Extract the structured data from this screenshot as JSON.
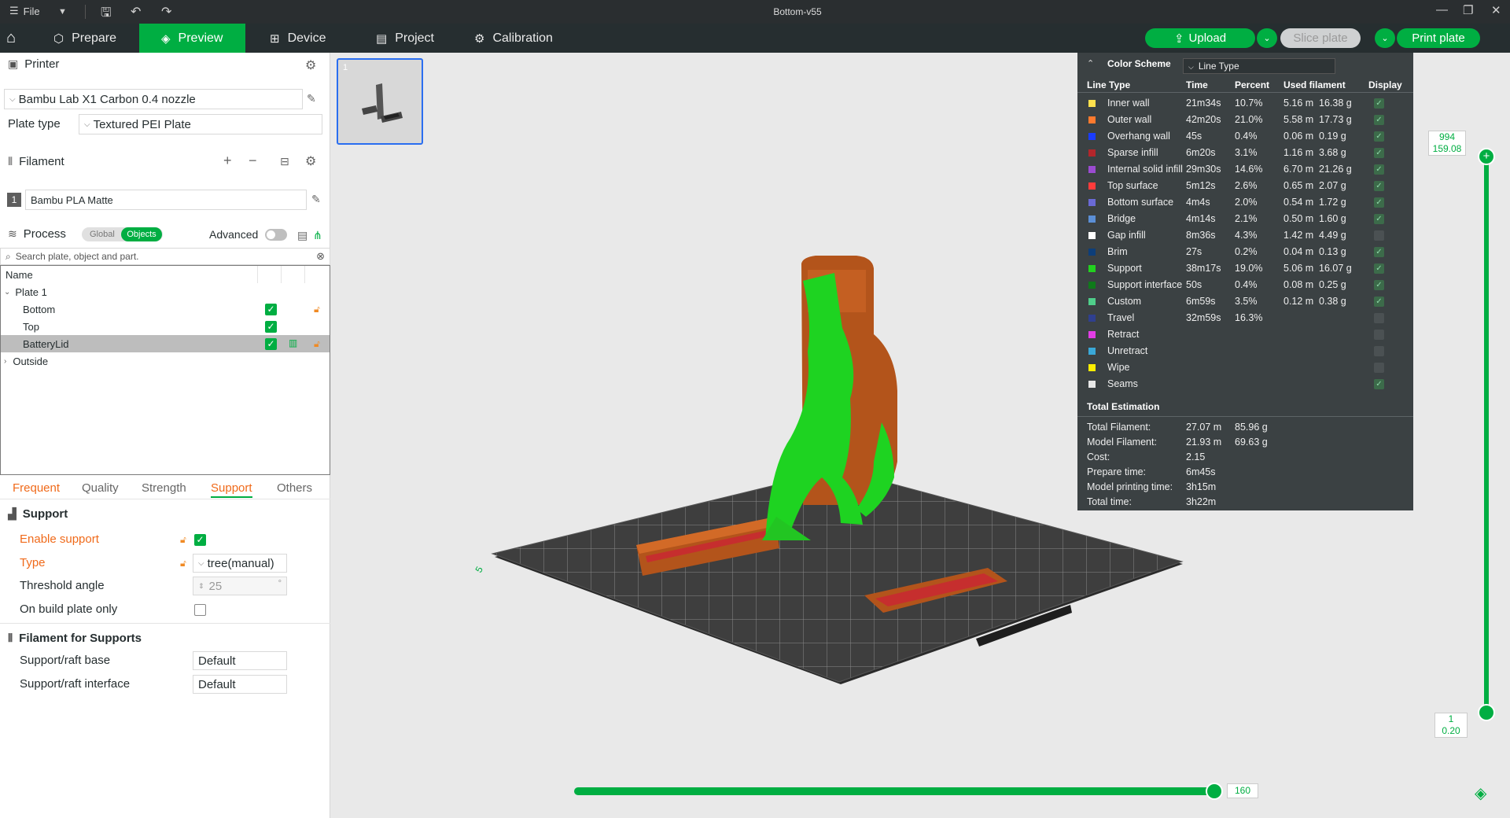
{
  "titlebar": {
    "file": "File",
    "title": "Bottom-v55"
  },
  "nav": {
    "tabs": [
      {
        "label": "Prepare"
      },
      {
        "label": "Preview"
      },
      {
        "label": "Device"
      },
      {
        "label": "Project"
      },
      {
        "label": "Calibration"
      }
    ],
    "upload": "Upload",
    "slice": "Slice plate",
    "print": "Print plate"
  },
  "printer": {
    "section": "Printer",
    "name": "Bambu Lab X1 Carbon 0.4 nozzle",
    "plate_type_label": "Plate type",
    "plate_type": "Textured PEI Plate"
  },
  "filament": {
    "section": "Filament",
    "index": "1",
    "name": "Bambu PLA Matte"
  },
  "process": {
    "section": "Process",
    "global": "Global",
    "objects": "Objects",
    "advanced": "Advanced",
    "search_placeholder": "Search plate, object and part."
  },
  "tree": {
    "header": "Name",
    "plate": "Plate 1",
    "items": [
      "Bottom",
      "Top",
      "BatteryLid"
    ],
    "outside": "Outside"
  },
  "subtabs": [
    "Frequent",
    "Quality",
    "Strength",
    "Support",
    "Others"
  ],
  "support": {
    "title": "Support",
    "enable": "Enable support",
    "type_label": "Type",
    "type_value": "tree(manual)",
    "threshold_label": "Threshold angle",
    "threshold_value": "25",
    "threshold_unit": "°",
    "buildplate": "On build plate only",
    "filament_title": "Filament for Supports",
    "base_label": "Support/raft base",
    "base_value": "Default",
    "iface_label": "Support/raft interface",
    "iface_value": "Default"
  },
  "plate_thumb": {
    "number": "1"
  },
  "legend": {
    "scheme_label": "Color Scheme",
    "scheme_value": "Line Type",
    "headers": {
      "type": "Line Type",
      "time": "Time",
      "percent": "Percent",
      "used": "Used filament",
      "display": "Display"
    },
    "rows": [
      {
        "name": "Inner wall",
        "color": "#ffe14d",
        "time": "21m34s",
        "pct": "10.7%",
        "len": "5.16 m",
        "wt": "16.38 g",
        "on": true
      },
      {
        "name": "Outer wall",
        "color": "#ff7a2e",
        "time": "42m20s",
        "pct": "21.0%",
        "len": "5.58 m",
        "wt": "17.73 g",
        "on": true
      },
      {
        "name": "Overhang wall",
        "color": "#1a3cff",
        "time": "45s",
        "pct": "0.4%",
        "len": "0.06 m",
        "wt": "0.19 g",
        "on": true
      },
      {
        "name": "Sparse infill",
        "color": "#b3262b",
        "time": "6m20s",
        "pct": "3.1%",
        "len": "1.16 m",
        "wt": "3.68 g",
        "on": true
      },
      {
        "name": "Internal solid infill",
        "color": "#9b4bd1",
        "time": "29m30s",
        "pct": "14.6%",
        "len": "6.70 m",
        "wt": "21.26 g",
        "on": true
      },
      {
        "name": "Top surface",
        "color": "#ff3b3b",
        "time": "5m12s",
        "pct": "2.6%",
        "len": "0.65 m",
        "wt": "2.07 g",
        "on": true
      },
      {
        "name": "Bottom surface",
        "color": "#6a6ad6",
        "time": "4m4s",
        "pct": "2.0%",
        "len": "0.54 m",
        "wt": "1.72 g",
        "on": true
      },
      {
        "name": "Bridge",
        "color": "#5b8fd6",
        "time": "4m14s",
        "pct": "2.1%",
        "len": "0.50 m",
        "wt": "1.60 g",
        "on": true
      },
      {
        "name": "Gap infill",
        "color": "#ffffff",
        "time": "8m36s",
        "pct": "4.3%",
        "len": "1.42 m",
        "wt": "4.49 g",
        "on": false
      },
      {
        "name": "Brim",
        "color": "#0d3e7a",
        "time": "27s",
        "pct": "0.2%",
        "len": "0.04 m",
        "wt": "0.13 g",
        "on": true
      },
      {
        "name": "Support",
        "color": "#22d11f",
        "time": "38m17s",
        "pct": "19.0%",
        "len": "5.06 m",
        "wt": "16.07 g",
        "on": true
      },
      {
        "name": "Support interface",
        "color": "#0f7a1a",
        "time": "50s",
        "pct": "0.4%",
        "len": "0.08 m",
        "wt": "0.25 g",
        "on": true
      },
      {
        "name": "Custom",
        "color": "#4fce8a",
        "time": "6m59s",
        "pct": "3.5%",
        "len": "0.12 m",
        "wt": "0.38 g",
        "on": true
      },
      {
        "name": "Travel",
        "color": "#2f3f8f",
        "time": "32m59s",
        "pct": "16.3%",
        "len": "",
        "wt": "",
        "on": false
      },
      {
        "name": "Retract",
        "color": "#e23de6",
        "time": "",
        "pct": "",
        "len": "",
        "wt": "",
        "on": false
      },
      {
        "name": "Unretract",
        "color": "#3aa8d8",
        "time": "",
        "pct": "",
        "len": "",
        "wt": "",
        "on": false
      },
      {
        "name": "Wipe",
        "color": "#ffee00",
        "time": "",
        "pct": "",
        "len": "",
        "wt": "",
        "on": false
      },
      {
        "name": "Seams",
        "color": "#e8e8e8",
        "time": "",
        "pct": "",
        "len": "",
        "wt": "",
        "on": true
      }
    ],
    "total_title": "Total Estimation",
    "totals": [
      {
        "k": "Total Filament:",
        "v1": "27.07 m",
        "v2": "85.96 g"
      },
      {
        "k": "Model Filament:",
        "v1": "21.93 m",
        "v2": "69.63 g"
      },
      {
        "k": "Cost:",
        "v1": "2.15",
        "v2": ""
      },
      {
        "k": "Prepare time:",
        "v1": "6m45s",
        "v2": ""
      },
      {
        "k": "Model printing time:",
        "v1": "3h15m",
        "v2": ""
      },
      {
        "k": "Total time:",
        "v1": "3h22m",
        "v2": ""
      }
    ]
  },
  "layer_slider": {
    "top_layer": "994",
    "top_height": "159.08",
    "bottom_layer": "1",
    "bottom_height": "0.20"
  },
  "move_slider": {
    "value": "160"
  }
}
